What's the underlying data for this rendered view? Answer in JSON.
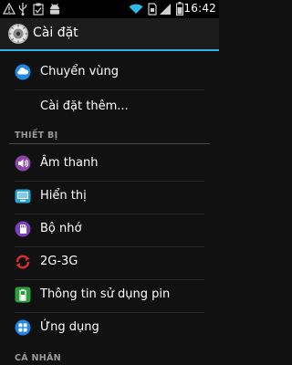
{
  "status_bar": {
    "time": "16:42",
    "icons": [
      "warning-icon",
      "usb-icon",
      "clipboard-check-icon",
      "android-debug-icon",
      "wifi-icon",
      "sim-card-icon",
      "signal-icon",
      "battery-icon"
    ]
  },
  "action_bar": {
    "title": "Cài đặt",
    "icon": "settings-app-icon"
  },
  "items": [
    {
      "label": "Chuyển vùng",
      "icon": "roaming-cloud-icon",
      "color": "#1e88e5"
    },
    {
      "label": "Cài đặt thêm...",
      "icon": "none"
    },
    {
      "label": "Âm thanh",
      "icon": "sound-icon",
      "color": "#8e44ad"
    },
    {
      "label": "Hiển thị",
      "icon": "display-icon",
      "color": "#29a3d6"
    },
    {
      "label": "Bộ nhớ",
      "icon": "storage-icon",
      "color": "#7e3fbf"
    },
    {
      "label": "2G-3G",
      "icon": "network-switch-icon",
      "color": "#d32f2f"
    },
    {
      "label": "Thông tin sử dụng pin",
      "icon": "battery-usage-icon",
      "color": "#2e9d3e"
    },
    {
      "label": "Ứng dụng",
      "icon": "apps-icon",
      "color": "#1e88e5"
    }
  ],
  "sections": {
    "device": "THIẾT BỊ",
    "personal": "CÁ NHÂN"
  }
}
